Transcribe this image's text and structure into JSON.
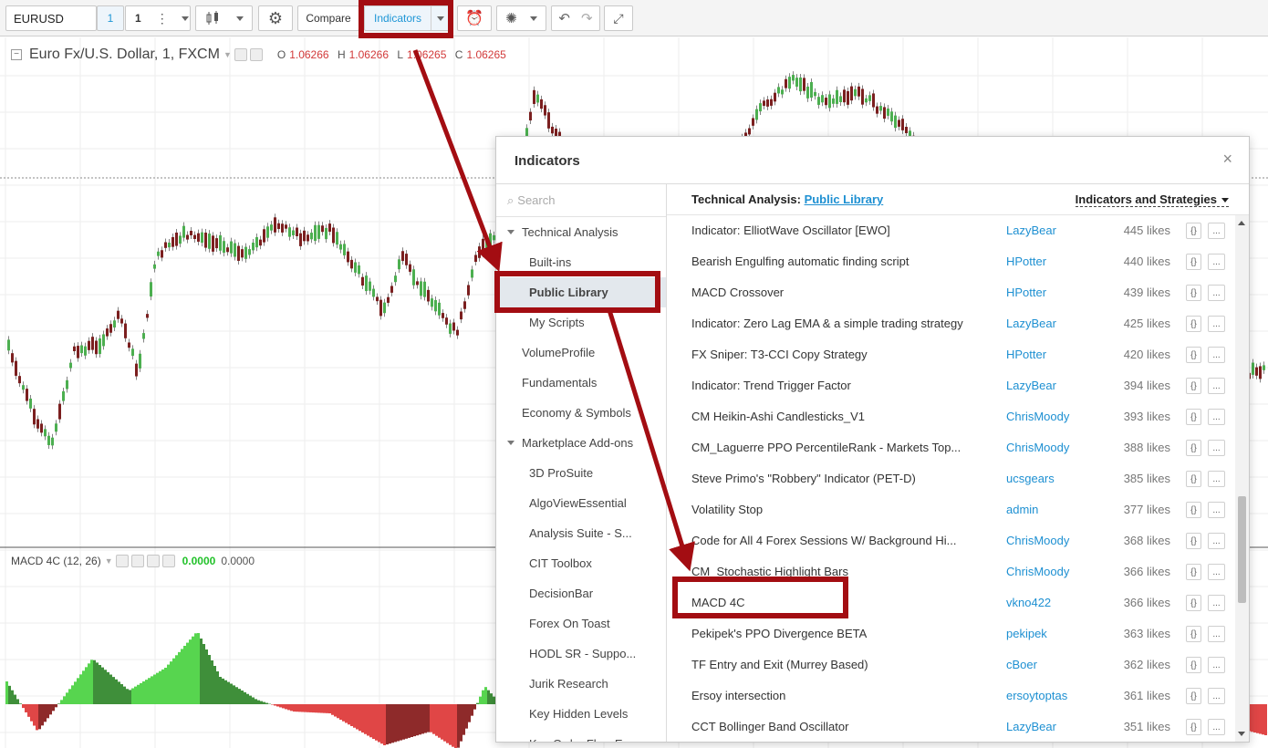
{
  "toolbar": {
    "symbol": "EURUSD",
    "interval_label": "1",
    "interval_value": "1",
    "compare_label": "Compare",
    "indicators_label": "Indicators"
  },
  "chart": {
    "title": "Euro Fx/U.S. Dollar, 1, FXCM",
    "ohlc": {
      "o_label": "O",
      "o_value": "1.06266",
      "h_label": "H",
      "h_value": "1.06266",
      "l_label": "L",
      "l_value": "1.06265",
      "c_label": "C",
      "c_value": "1.06265"
    },
    "macd": {
      "label": "MACD 4C (12, 26)",
      "value1": "0.0000",
      "value2": "0.0000"
    },
    "colors": {
      "up": "#4caf50",
      "down": "#7b1f1f",
      "hist_pos": "#57d54f",
      "hist_pos_dark": "#3f8f3a",
      "hist_neg": "#e04646",
      "hist_neg_dark": "#8e2a2a"
    }
  },
  "dialog": {
    "title": "Indicators",
    "close": "×",
    "search_placeholder": "Search",
    "nav": [
      {
        "label": "Technical Analysis"
      },
      {
        "label": "Built-ins"
      },
      {
        "label": "Public Library"
      },
      {
        "label": "My Scripts"
      },
      {
        "label": "VolumeProfile"
      },
      {
        "label": "Fundamentals"
      },
      {
        "label": "Economy & Symbols"
      },
      {
        "label": "Marketplace Add-ons"
      },
      {
        "label": "3D ProSuite"
      },
      {
        "label": "AlgoViewEssential"
      },
      {
        "label": "Analysis Suite - S..."
      },
      {
        "label": "CIT Toolbox"
      },
      {
        "label": "DecisionBar"
      },
      {
        "label": "Forex On Toast"
      },
      {
        "label": "HODL SR - Suppo..."
      },
      {
        "label": "Jurik Research"
      },
      {
        "label": "Key Hidden Levels"
      },
      {
        "label": "Key Order Flow E..."
      }
    ],
    "breadcrumb_prefix": "Technical Analysis:",
    "breadcrumb_link": "Public Library",
    "filter_label": "Indicators and Strategies",
    "row_btn1": "{}",
    "row_btn2": "...",
    "rows": [
      {
        "name": "Indicator: ElliotWave Oscillator [EWO]",
        "author": "LazyBear",
        "likes": "445 likes"
      },
      {
        "name": "Bearish Engulfing automatic finding script",
        "author": "HPotter",
        "likes": "440 likes"
      },
      {
        "name": "MACD Crossover",
        "author": "HPotter",
        "likes": "439 likes"
      },
      {
        "name": "Indicator: Zero Lag EMA & a simple trading strategy",
        "author": "LazyBear",
        "likes": "425 likes"
      },
      {
        "name": "FX Sniper: T3-CCI Copy Strategy",
        "author": "HPotter",
        "likes": "420 likes"
      },
      {
        "name": "Indicator: Trend Trigger Factor",
        "author": "LazyBear",
        "likes": "394 likes"
      },
      {
        "name": "CM Heikin-Ashi Candlesticks_V1",
        "author": "ChrisMoody",
        "likes": "393 likes"
      },
      {
        "name": "CM_Laguerre PPO PercentileRank - Markets Top...",
        "author": "ChrisMoody",
        "likes": "388 likes"
      },
      {
        "name": "Steve Primo's \"Robbery\" Indicator (PET-D)",
        "author": "ucsgears",
        "likes": "385 likes"
      },
      {
        "name": "Volatility Stop",
        "author": "admin",
        "likes": "377 likes"
      },
      {
        "name": "Code for All 4 Forex Sessions W/ Background Hi...",
        "author": "ChrisMoody",
        "likes": "368 likes"
      },
      {
        "name": "CM_Stochastic Highlight Bars",
        "author": "ChrisMoody",
        "likes": "366 likes"
      },
      {
        "name": "MACD 4C",
        "author": "vkno422",
        "likes": "366 likes"
      },
      {
        "name": "Pekipek's PPO Divergence BETA",
        "author": "pekipek",
        "likes": "363 likes"
      },
      {
        "name": "TF Entry and Exit (Murrey Based)",
        "author": "cBoer",
        "likes": "362 likes"
      },
      {
        "name": "Ersoy intersection",
        "author": "ersoytoptas",
        "likes": "361 likes"
      },
      {
        "name": "CCT Bollinger Band Oscillator",
        "author": "LazyBear",
        "likes": "351 likes"
      }
    ]
  },
  "annotation_color": "#a30d12"
}
